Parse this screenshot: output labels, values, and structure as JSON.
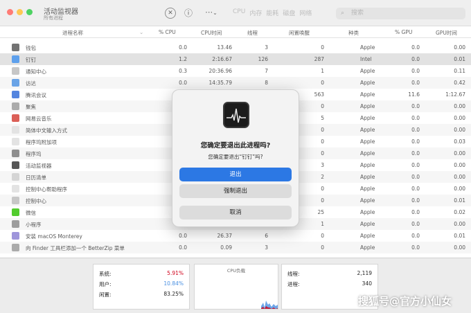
{
  "window": {
    "title": "活动监视器",
    "subtitle": "所有进程",
    "traffic_lights": {
      "close": "#ff5f57",
      "minimize": "#febc2e",
      "zoom": "#28c840"
    }
  },
  "toolbar": {
    "stop_icon": "✕",
    "info_icon": "ⓘ",
    "more_icon": "⋯",
    "more_caret": "⌄",
    "tabs": [
      "CPU",
      "内存",
      "能耗",
      "磁盘",
      "网络"
    ],
    "search_placeholder": "搜索",
    "search_icon": "⌕"
  },
  "table": {
    "headers": {
      "name": "进程名称",
      "cpu": "% CPU",
      "cpu_time": "CPU时间",
      "threads": "线程",
      "idle_wake": "闲置唤醒",
      "kind": "种类",
      "gpu": "% GPU",
      "gpu_time": "GPU时间"
    },
    "rows": [
      {
        "name": "钱包",
        "cpu": "0.0",
        "cpu_time": "13.46",
        "threads": "3",
        "idle": "0",
        "kind": "Apple",
        "gpu": "0.0",
        "gpu_time": "0.00",
        "icon_color": "#555"
      },
      {
        "name": "钉钉",
        "cpu": "1.2",
        "cpu_time": "2:16.67",
        "threads": "126",
        "idle": "287",
        "kind": "Intel",
        "gpu": "0.0",
        "gpu_time": "0.01",
        "icon_color": "#3b8be8"
      },
      {
        "name": "通知中心",
        "cpu": "0.3",
        "cpu_time": "20:36.96",
        "threads": "7",
        "idle": "1",
        "kind": "Apple",
        "gpu": "0.0",
        "gpu_time": "0.11",
        "icon_color": "#bbb"
      },
      {
        "name": "访达",
        "cpu": "0.0",
        "cpu_time": "14:35.79",
        "threads": "8",
        "idle": "0",
        "kind": "Apple",
        "gpu": "0.0",
        "gpu_time": "0.42",
        "icon_color": "#4a90e2"
      },
      {
        "name": "腾讯会议",
        "cpu": "",
        "cpu_time": "",
        "threads": "",
        "idle": "563",
        "kind": "Apple",
        "gpu": "11.6",
        "gpu_time": "1:12.67",
        "icon_color": "#2f6bd8"
      },
      {
        "name": "聚焦",
        "cpu": "",
        "cpu_time": "",
        "threads": "",
        "idle": "0",
        "kind": "Apple",
        "gpu": "0.0",
        "gpu_time": "0.00",
        "icon_color": "#999"
      },
      {
        "name": "网易云音乐",
        "cpu": "",
        "cpu_time": "",
        "threads": "",
        "idle": "5",
        "kind": "Apple",
        "gpu": "0.0",
        "gpu_time": "0.00",
        "icon_color": "#d43c33"
      },
      {
        "name": "简体中文输入方式",
        "cpu": "",
        "cpu_time": "",
        "threads": "",
        "idle": "0",
        "kind": "Apple",
        "gpu": "0.0",
        "gpu_time": "0.00",
        "icon_color": "#ddd"
      },
      {
        "name": "程序坞附加项",
        "cpu": "",
        "cpu_time": "",
        "threads": "",
        "idle": "0",
        "kind": "Apple",
        "gpu": "0.0",
        "gpu_time": "0.03",
        "icon_color": "#ddd"
      },
      {
        "name": "程序坞",
        "cpu": "",
        "cpu_time": "",
        "threads": "",
        "idle": "0",
        "kind": "Apple",
        "gpu": "0.0",
        "gpu_time": "0.00",
        "icon_color": "#777"
      },
      {
        "name": "活动监视器",
        "cpu": "",
        "cpu_time": "",
        "threads": "",
        "idle": "3",
        "kind": "Apple",
        "gpu": "0.0",
        "gpu_time": "0.00",
        "icon_color": "#333"
      },
      {
        "name": "日历清单",
        "cpu": "",
        "cpu_time": "",
        "threads": "",
        "idle": "2",
        "kind": "Apple",
        "gpu": "0.0",
        "gpu_time": "0.00",
        "icon_color": "#ccc"
      },
      {
        "name": "控制中心帮助程序",
        "cpu": "",
        "cpu_time": "",
        "threads": "",
        "idle": "0",
        "kind": "Apple",
        "gpu": "0.0",
        "gpu_time": "0.00",
        "icon_color": "#ddd"
      },
      {
        "name": "控制中心",
        "cpu": "",
        "cpu_time": "",
        "threads": "",
        "idle": "0",
        "kind": "Apple",
        "gpu": "0.0",
        "gpu_time": "0.01",
        "icon_color": "#bbb"
      },
      {
        "name": "微信",
        "cpu": "",
        "cpu_time": "",
        "threads": "",
        "idle": "25",
        "kind": "Apple",
        "gpu": "0.0",
        "gpu_time": "0.02",
        "icon_color": "#2dc100"
      },
      {
        "name": "小程序",
        "cpu": "",
        "cpu_time": "",
        "threads": "",
        "idle": "1",
        "kind": "Apple",
        "gpu": "0.0",
        "gpu_time": "0.00",
        "icon_color": "#888"
      },
      {
        "name": "安装 macOS Monterey",
        "cpu": "0.0",
        "cpu_time": "26.37",
        "threads": "6",
        "idle": "0",
        "kind": "Apple",
        "gpu": "0.0",
        "gpu_time": "0.01",
        "icon_color": "#8a7fd4"
      },
      {
        "name": "向 Finder 工具栏添加一个 BetterZip 菜单",
        "cpu": "0.0",
        "cpu_time": "0.09",
        "threads": "3",
        "idle": "0",
        "kind": "Apple",
        "gpu": "0.0",
        "gpu_time": "0.00",
        "icon_color": "#999"
      }
    ]
  },
  "summary": {
    "system_label": "系统:",
    "system_value": "5.91%",
    "user_label": "用户:",
    "user_value": "10.84%",
    "idle_label": "闲置:",
    "idle_value": "83.25%",
    "chart_title": "CPU负载",
    "threads_label": "线程:",
    "threads_value": "2,119",
    "procs_label": "进程:",
    "procs_value": "340",
    "system_color": "#d0021b",
    "user_color": "#4a90e2"
  },
  "dialog": {
    "title": "您确定要退出此进程吗?",
    "message": "您确定要退出“钉钉”吗?",
    "quit_label": "退出",
    "force_quit_label": "强制退出",
    "cancel_label": "取消",
    "primary_color": "#2c78e4"
  },
  "watermark": "搜狐号@官方小仙女"
}
